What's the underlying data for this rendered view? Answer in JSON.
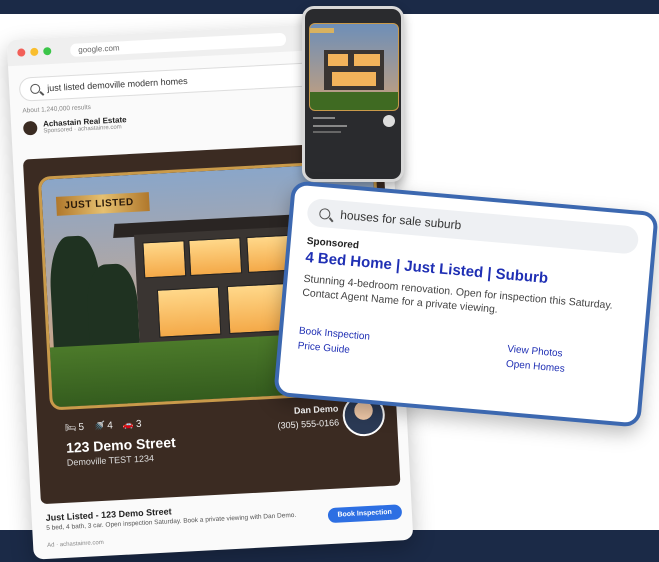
{
  "colors": {
    "navy": "#1b2a47",
    "gold": "#c99a4a",
    "card_brown": "#3b2b22",
    "link_blue": "#1f2fb4",
    "popup_border": "#3c68b0",
    "button_blue": "#2d6fe3"
  },
  "browser": {
    "url": "google.com",
    "search_query": "just listed demoville modern homes",
    "results_count": "About 1,240,000 results",
    "advertiser": {
      "name": "Achastain Real Estate",
      "sponsored_line": "Sponsored · achastainre.com"
    }
  },
  "listing": {
    "badge": "JUST LISTED",
    "beds": "5",
    "baths": "4",
    "cars": "3",
    "street": "123 Demo Street",
    "suburb": "Demoville TEST 1234",
    "agent_name": "Dan Demo",
    "agent_phone": "(305) 555-0166"
  },
  "ad": {
    "title": "Just Listed - 123 Demo Street",
    "description": "5 bed, 4 bath, 3 car. Open inspection Saturday. Book a private viewing with Dan Demo.",
    "display_url": "Ad · achastainre.com",
    "button": "Book Inspection"
  },
  "search_ad": {
    "query": "houses for sale suburb",
    "sponsored": "Sponsored",
    "headline": "4 Bed Home | Just Listed | Suburb",
    "description": "Stunning 4-bedroom renovation. Open for inspection this Saturday. Contact Agent Name for a private viewing.",
    "links_left": [
      "Book Inspection",
      "Price Guide"
    ],
    "links_right": [
      "View Photos",
      "Open Homes"
    ]
  }
}
